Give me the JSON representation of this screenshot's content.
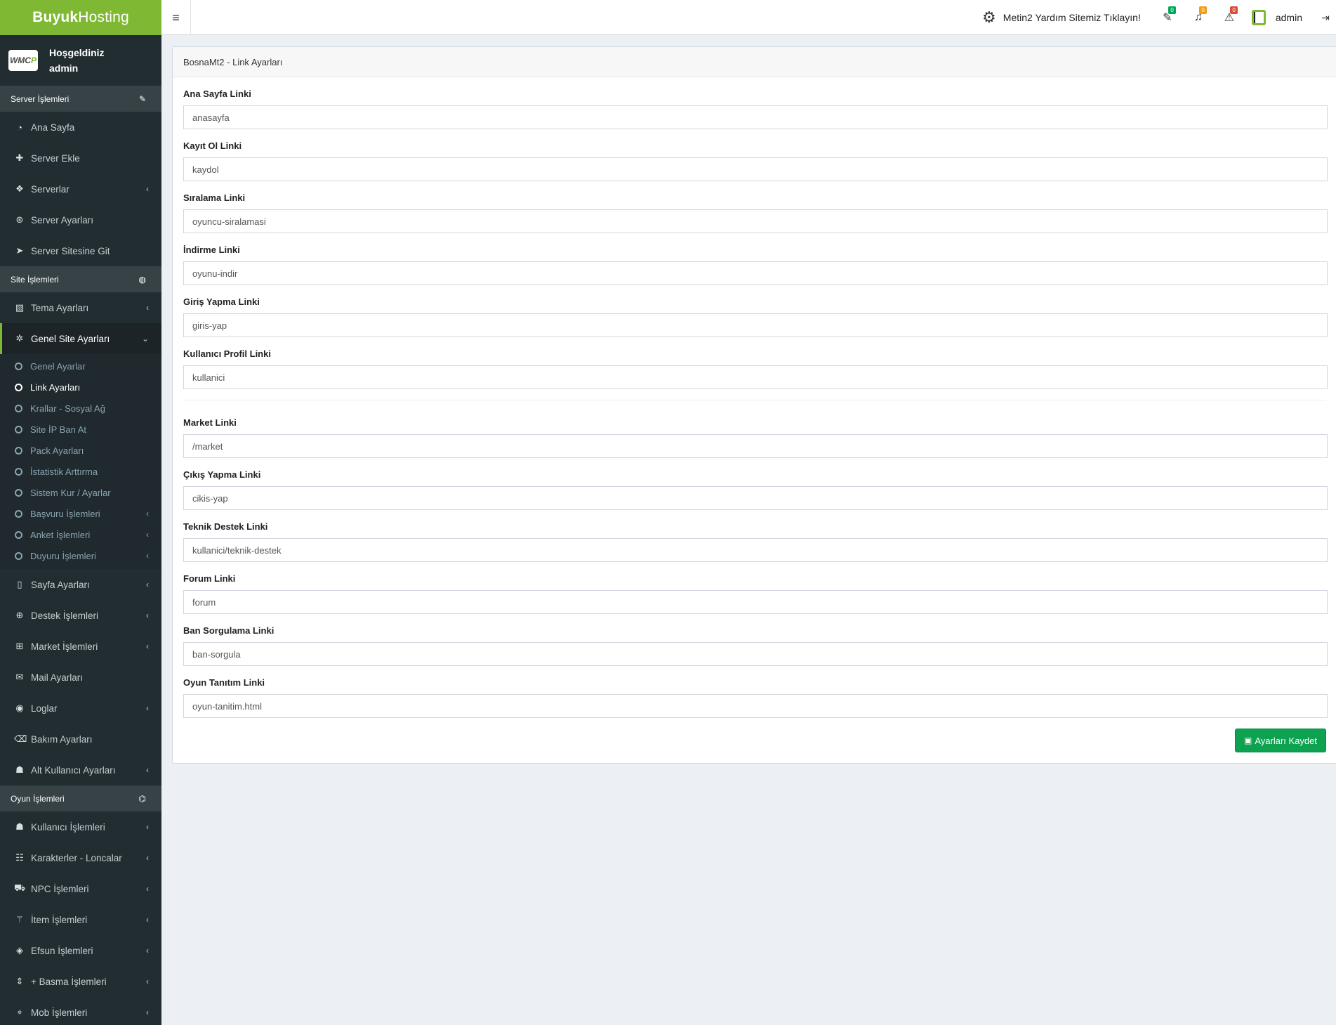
{
  "brand": {
    "bold": "Buyuk",
    "light": "Hosting",
    "color": "#7fb832"
  },
  "user_panel": {
    "avatar_text": "WMC",
    "avatar_accent": "P",
    "greeting": "Hoşgeldiniz",
    "username": "admin"
  },
  "sidebar": {
    "section_server": {
      "label": "Server İşlemleri",
      "icon": "wrench-icon"
    },
    "server_items": [
      {
        "label": "Ana Sayfa",
        "icon": "dashboard-icon",
        "glyph": "◔",
        "chevron": false
      },
      {
        "label": "Server Ekle",
        "icon": "plus-icon",
        "glyph": "✚",
        "chevron": false
      },
      {
        "label": "Serverlar",
        "icon": "cubes-icon",
        "glyph": "❖",
        "chevron": true
      },
      {
        "label": "Server Ayarları",
        "icon": "dribbble-icon",
        "glyph": "⊛",
        "chevron": false
      },
      {
        "label": "Server Sitesine Git",
        "icon": "paper-plane-icon",
        "glyph": "➤",
        "chevron": false
      }
    ],
    "section_site": {
      "label": "Site İşlemleri",
      "icon": "globe-icon"
    },
    "site_items_top": [
      {
        "label": "Tema Ayarları",
        "icon": "image-icon",
        "glyph": "▨",
        "chevron": true
      }
    ],
    "active_item": {
      "label": "Genel Site Ayarları",
      "icon": "cog-icon",
      "glyph": "✲",
      "chevron": "⌄"
    },
    "submenu": [
      {
        "label": "Genel Ayarlar",
        "chevron": false,
        "current": false
      },
      {
        "label": "Link Ayarları",
        "chevron": false,
        "current": true
      },
      {
        "label": "Krallar - Sosyal Ağ",
        "chevron": false,
        "current": false
      },
      {
        "label": "Site İP Ban At",
        "chevron": false,
        "current": false
      },
      {
        "label": "Pack Ayarları",
        "chevron": false,
        "current": false
      },
      {
        "label": "İstatistik Arttırma",
        "chevron": false,
        "current": false
      },
      {
        "label": "Sistem Kur / Ayarlar",
        "chevron": false,
        "current": false
      },
      {
        "label": "Başvuru İşlemleri",
        "chevron": true,
        "current": false
      },
      {
        "label": "Anket İşlemleri",
        "chevron": true,
        "current": false
      },
      {
        "label": "Duyuru İşlemleri",
        "chevron": true,
        "current": false
      }
    ],
    "site_items_bottom": [
      {
        "label": "Sayfa Ayarları",
        "icon": "file-icon",
        "glyph": "▯",
        "chevron": true
      },
      {
        "label": "Destek İşlemleri",
        "icon": "globe-icon",
        "glyph": "⊕",
        "chevron": true
      },
      {
        "label": "Market İşlemleri",
        "icon": "basket-icon",
        "glyph": "⊞",
        "chevron": true
      },
      {
        "label": "Mail Ayarları",
        "icon": "envelope-icon",
        "glyph": "✉",
        "chevron": false
      },
      {
        "label": "Loglar",
        "icon": "eye-icon",
        "glyph": "◉",
        "chevron": true
      },
      {
        "label": "Bakım Ayarları",
        "icon": "eraser-icon",
        "glyph": "⌫",
        "chevron": false
      },
      {
        "label": "Alt Kullanıcı Ayarları",
        "icon": "user-icon",
        "glyph": "☗",
        "chevron": true
      }
    ],
    "section_game": {
      "label": "Oyun İşlemleri",
      "icon": "gamepad-icon"
    },
    "game_items": [
      {
        "label": "Kullanıcı İşlemleri",
        "icon": "user-icon",
        "glyph": "☗",
        "chevron": true
      },
      {
        "label": "Karakterler - Loncalar",
        "icon": "users-icon",
        "glyph": "☷",
        "chevron": true
      },
      {
        "label": "NPC İşlemleri",
        "icon": "cart-icon",
        "glyph": "⛟",
        "chevron": true
      },
      {
        "label": "İtem İşlemleri",
        "icon": "magic-icon",
        "glyph": "⚚",
        "chevron": true
      },
      {
        "label": "Efsun İşlemleri",
        "icon": "diamond-icon",
        "glyph": "◈",
        "chevron": true
      },
      {
        "label": "+ Basma İşlemleri",
        "icon": "sort-icon",
        "glyph": "⇕",
        "chevron": true
      },
      {
        "label": "Mob İşlemleri",
        "icon": "crosshairs-icon",
        "glyph": "⌖",
        "chevron": true
      }
    ]
  },
  "topbar": {
    "help_text": "Metin2 Yardım Sitemiz Tıklayın!",
    "badges": {
      "tickets": "0",
      "notifications": "0",
      "warnings": "0"
    },
    "username": "admin"
  },
  "main": {
    "title": "BosnaMt2 - Link Ayarları",
    "fields_group1": [
      {
        "label": "Ana Sayfa Linki",
        "value": "anasayfa"
      },
      {
        "label": "Kayıt Ol Linki",
        "value": "kaydol"
      },
      {
        "label": "Sıralama Linki",
        "value": "oyuncu-siralamasi"
      },
      {
        "label": "İndirme Linki",
        "value": "oyunu-indir"
      },
      {
        "label": "Giriş Yapma Linki",
        "value": "giris-yap"
      },
      {
        "label": "Kullanıcı Profil Linki",
        "value": "kullanici"
      }
    ],
    "fields_group2": [
      {
        "label": "Market Linki",
        "value": "/market"
      },
      {
        "label": "Çıkış Yapma Linki",
        "value": "cikis-yap"
      },
      {
        "label": "Teknik Destek Linki",
        "value": "kullanici/teknik-destek"
      },
      {
        "label": "Forum Linki",
        "value": "forum"
      },
      {
        "label": "Ban Sorgulama Linki",
        "value": "ban-sorgula"
      },
      {
        "label": "Oyun Tanıtım Linki",
        "value": "oyun-tanitim.html"
      }
    ],
    "save_label": "Ayarları Kaydet"
  }
}
